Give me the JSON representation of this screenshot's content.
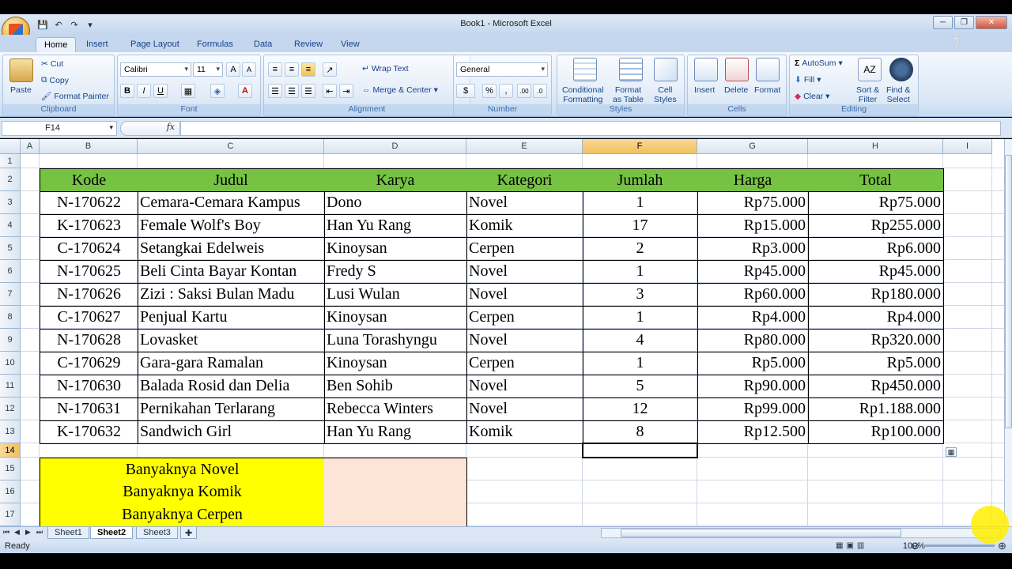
{
  "window": {
    "title": "Book1 - Microsoft Excel",
    "minimize": "─",
    "restore": "❐",
    "close": "✕"
  },
  "quick_access": [
    "💾",
    "↶",
    "↷",
    "▾"
  ],
  "tabs": [
    "Home",
    "Insert",
    "Page Layout",
    "Formulas",
    "Data",
    "Review",
    "View"
  ],
  "ribbon": {
    "clipboard": {
      "label": "Clipboard",
      "paste": "Paste",
      "cut": "Cut",
      "copy": "Copy",
      "format_painter": "Format Painter"
    },
    "font": {
      "label": "Font",
      "font_name": "Calibri",
      "font_size": "11",
      "bold": "B",
      "italic": "I",
      "underline": "U",
      "grow": "A",
      "shrink": "A",
      "font_color": "A"
    },
    "alignment": {
      "label": "Alignment",
      "wrap_text": "Wrap Text",
      "merge_center": "Merge & Center"
    },
    "number": {
      "label": "Number",
      "format": "General",
      "percent": "%",
      "comma": ",",
      "inc_dec": ".00",
      "dec_dec": ".0"
    },
    "styles": {
      "label": "Styles",
      "conditional": "Conditional",
      "conditional2": "Formatting",
      "format_table": "Format",
      "format_table2": "as Table",
      "cell_styles": "Cell",
      "cell_styles2": "Styles"
    },
    "cells": {
      "label": "Cells",
      "insert": "Insert",
      "delete": "Delete",
      "format": "Format"
    },
    "editing": {
      "label": "Editing",
      "autosum": "AutoSum",
      "fill": "Fill",
      "clear": "Clear",
      "sort": "Sort &",
      "sort2": "Filter",
      "find": "Find &",
      "find2": "Select"
    }
  },
  "formula_bar": {
    "name_box": "F14",
    "fx": "fx",
    "value": ""
  },
  "columns": [
    "A",
    "B",
    "C",
    "D",
    "E",
    "F",
    "G",
    "H",
    "I"
  ],
  "rows": [
    "1",
    "2",
    "3",
    "4",
    "5",
    "6",
    "7",
    "8",
    "9",
    "10",
    "11",
    "12",
    "13",
    "14",
    "15",
    "16",
    "17"
  ],
  "table": {
    "headers": [
      "Kode",
      "Judul",
      "Karya",
      "Kategori",
      "Jumlah",
      "Harga",
      "Total"
    ],
    "rows": [
      [
        "N-170622",
        "Cemara-Cemara Kampus",
        "Dono",
        "Novel",
        "1",
        "Rp75.000",
        "Rp75.000"
      ],
      [
        "K-170623",
        "Female Wolf's Boy",
        "Han Yu Rang",
        "Komik",
        "17",
        "Rp15.000",
        "Rp255.000"
      ],
      [
        "C-170624",
        "Setangkai Edelweis",
        "Kinoysan",
        "Cerpen",
        "2",
        "Rp3.000",
        "Rp6.000"
      ],
      [
        "N-170625",
        "Beli Cinta Bayar Kontan",
        "Fredy S",
        "Novel",
        "1",
        "Rp45.000",
        "Rp45.000"
      ],
      [
        "N-170626",
        "Zizi : Saksi Bulan Madu",
        "Lusi Wulan",
        "Novel",
        "3",
        "Rp60.000",
        "Rp180.000"
      ],
      [
        "C-170627",
        "Penjual Kartu",
        "Kinoysan",
        "Cerpen",
        "1",
        "Rp4.000",
        "Rp4.000"
      ],
      [
        "N-170628",
        "Lovasket",
        "Luna Torashyngu",
        "Novel",
        "4",
        "Rp80.000",
        "Rp320.000"
      ],
      [
        "C-170629",
        "Gara-gara Ramalan",
        "Kinoysan",
        "Cerpen",
        "1",
        "Rp5.000",
        "Rp5.000"
      ],
      [
        "N-170630",
        "Balada Rosid dan Delia",
        "Ben Sohib",
        "Novel",
        "5",
        "Rp90.000",
        "Rp450.000"
      ],
      [
        "N-170631",
        "Pernikahan Terlarang",
        "Rebecca Winters",
        "Novel",
        "12",
        "Rp99.000",
        "Rp1.188.000"
      ],
      [
        "K-170632",
        "Sandwich Girl",
        "Han Yu Rang",
        "Komik",
        "8",
        "Rp12.500",
        "Rp100.000"
      ]
    ]
  },
  "summary": [
    {
      "label": "Banyaknya Novel",
      "value": ""
    },
    {
      "label": "Banyaknya Komik",
      "value": ""
    },
    {
      "label": "Banyaknya Cerpen",
      "value": ""
    }
  ],
  "sheets": [
    "Sheet1",
    "Sheet2",
    "Sheet3"
  ],
  "active_sheet": "Sheet2",
  "status": {
    "ready": "Ready",
    "zoom": "100%"
  },
  "colors": {
    "header_green": "#76c243",
    "summary_yellow": "#ffff00",
    "summary_peach": "#fce4d6",
    "selected_header": "#f1c05c"
  }
}
